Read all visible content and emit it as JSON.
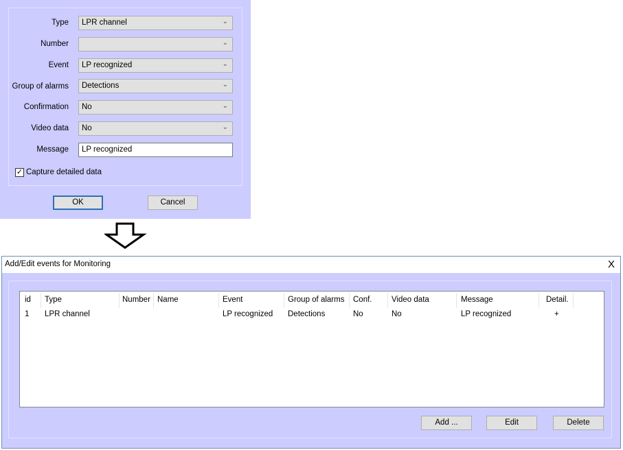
{
  "form": {
    "fields": [
      {
        "label": "Type",
        "value": "LPR channel",
        "kind": "combo"
      },
      {
        "label": "Number",
        "value": "",
        "kind": "combo"
      },
      {
        "label": "Event",
        "value": "LP recognized",
        "kind": "combo"
      },
      {
        "label": "Group of alarms",
        "value": "Detections",
        "kind": "combo"
      },
      {
        "label": "Confirmation",
        "value": "No",
        "kind": "combo"
      },
      {
        "label": "Video data",
        "value": "No",
        "kind": "combo"
      },
      {
        "label": "Message",
        "value": "LP recognized",
        "kind": "edit"
      }
    ],
    "capture_label": "Capture detailed data",
    "capture_checked": true,
    "ok_label": "OK",
    "cancel_label": "Cancel"
  },
  "window": {
    "title": "Add/Edit events for Monitoring",
    "close": "X",
    "columns": [
      "id",
      "Type",
      "Number",
      "Name",
      "Event",
      "Group of alarms",
      "Conf.",
      "Video data",
      "Message",
      "Detail."
    ],
    "rows": [
      [
        "1",
        "LPR channel",
        "",
        "",
        "LP recognized",
        "Detections",
        "No",
        "No",
        "LP recognized",
        "+"
      ]
    ],
    "add_label": "Add ...",
    "edit_label": "Edit",
    "delete_label": "Delete"
  }
}
